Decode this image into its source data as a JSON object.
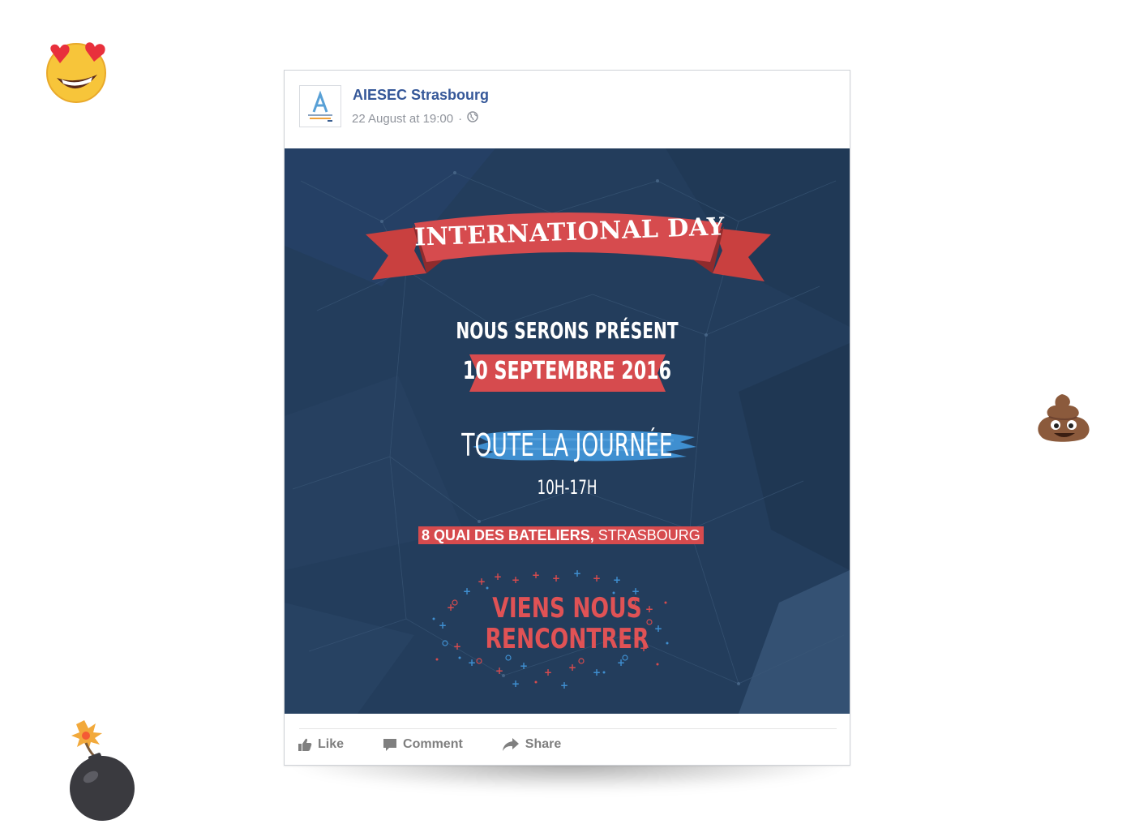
{
  "post": {
    "page_name": "AIESEC Strasbourg",
    "timestamp": "22 August at 19:00",
    "separator": "·",
    "privacy_icon": "globe-icon"
  },
  "flyer": {
    "banner": "INTERNATIONAL DAY",
    "tagline": "NOUS SERONS PRÉSENT",
    "date": "10 SEPTEMBRE 2016",
    "daylong": "TOUTE LA JOURNÉE",
    "hours": "10H-17H",
    "address": "8 QUAI DES BATELIERS,",
    "city": "STRASBOURG",
    "cta_line1": "VIENS NOUS",
    "cta_line2": "RENCONTRER"
  },
  "actions": {
    "like": "Like",
    "comment": "Comment",
    "share": "Share"
  },
  "decorations": [
    "heart-eyes-emoji",
    "poop-emoji",
    "bomb-emoji"
  ],
  "colors": {
    "brand_blue": "#365899",
    "flyer_background": "#233d5c",
    "ribbon_red": "#d64b4e",
    "brush_blue": "#3f8fd0",
    "meta_grey": "#90949c"
  }
}
